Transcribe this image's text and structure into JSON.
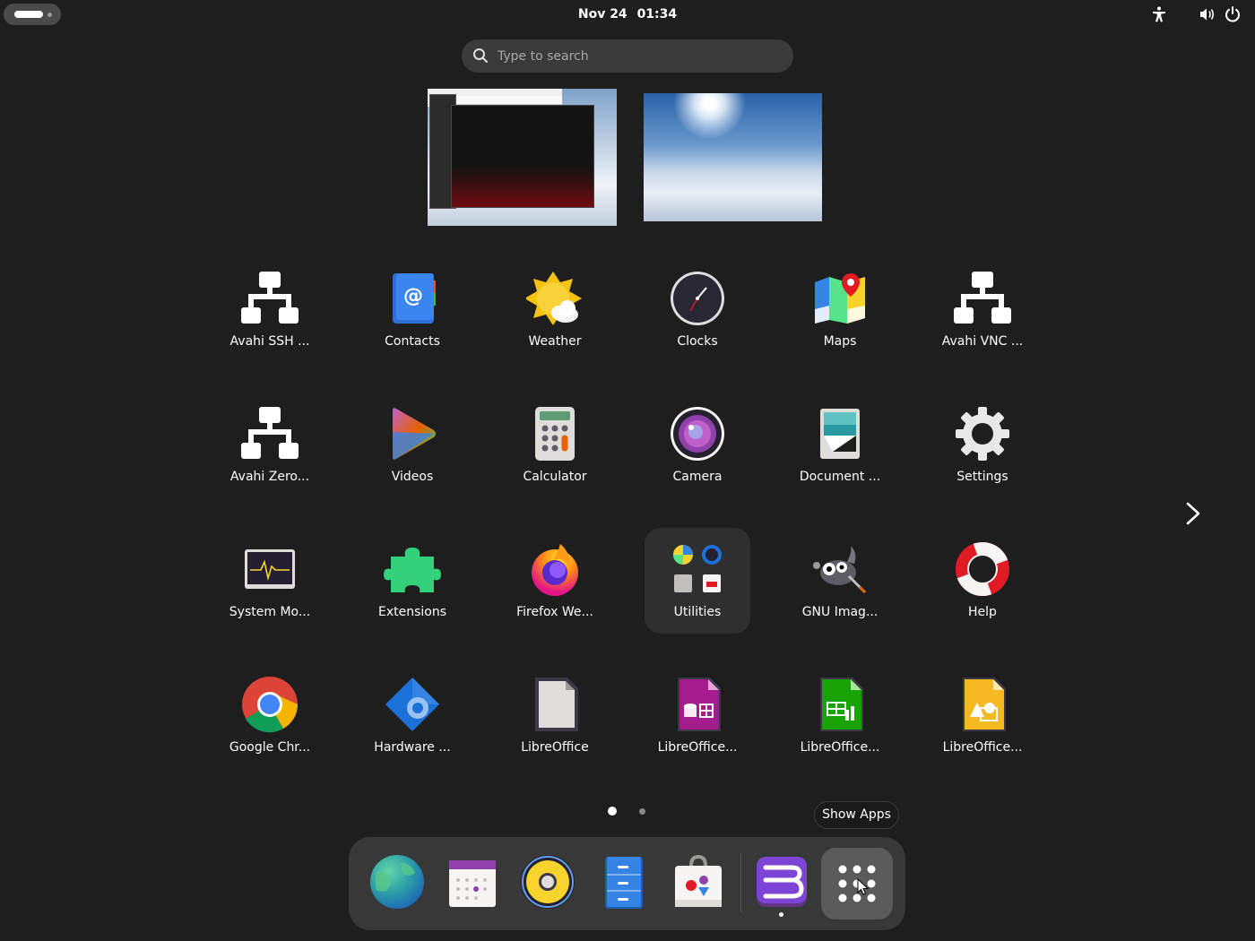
{
  "topbar": {
    "date": "Nov 24",
    "time": "01:34"
  },
  "search": {
    "placeholder": "Type to search"
  },
  "apps": [
    {
      "label": "Avahi SSH ...",
      "icon": "network-icon"
    },
    {
      "label": "Contacts",
      "icon": "contacts-icon"
    },
    {
      "label": "Weather",
      "icon": "weather-icon"
    },
    {
      "label": "Clocks",
      "icon": "clock-icon"
    },
    {
      "label": "Maps",
      "icon": "map-icon"
    },
    {
      "label": "Avahi VNC ...",
      "icon": "network-icon"
    },
    {
      "label": "Avahi Zero...",
      "icon": "network-icon"
    },
    {
      "label": "Videos",
      "icon": "videos-icon"
    },
    {
      "label": "Calculator",
      "icon": "calculator-icon"
    },
    {
      "label": "Camera",
      "icon": "camera-icon"
    },
    {
      "label": "Document ...",
      "icon": "document-scanner-icon"
    },
    {
      "label": "Settings",
      "icon": "gear-icon"
    },
    {
      "label": "System Mo...",
      "icon": "system-monitor-icon"
    },
    {
      "label": "Extensions",
      "icon": "puzzle-icon"
    },
    {
      "label": "Firefox We...",
      "icon": "firefox-icon"
    },
    {
      "label": "Utilities",
      "icon": "folder-icon"
    },
    {
      "label": "GNU Imag...",
      "icon": "gimp-icon"
    },
    {
      "label": "Help",
      "icon": "lifebuoy-icon"
    },
    {
      "label": "Google Chr...",
      "icon": "chrome-icon"
    },
    {
      "label": "Hardware ...",
      "icon": "hardware-icon"
    },
    {
      "label": "LibreOffice",
      "icon": "libreoffice-icon"
    },
    {
      "label": "LibreOffice...",
      "icon": "libreoffice-base-icon"
    },
    {
      "label": "LibreOffice...",
      "icon": "libreoffice-calc-icon"
    },
    {
      "label": "LibreOffice...",
      "icon": "libreoffice-draw-icon"
    }
  ],
  "pager": {
    "current_page": 1,
    "total_pages": 2
  },
  "tooltip": {
    "text": "Show Apps"
  },
  "dock": [
    {
      "icon": "globe-icon"
    },
    {
      "icon": "calendar-icon"
    },
    {
      "icon": "speaker-icon"
    },
    {
      "icon": "file-cabinet-icon"
    },
    {
      "icon": "software-store-icon"
    },
    {
      "icon": "text-editor-icon"
    },
    {
      "icon": "show-apps-icon"
    }
  ]
}
